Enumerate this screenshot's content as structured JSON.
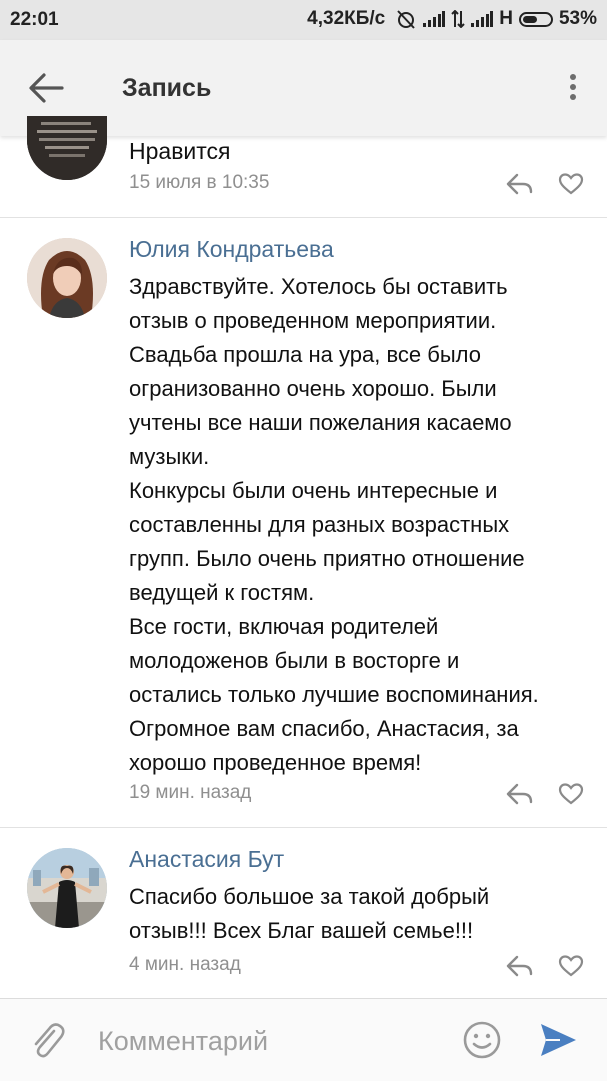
{
  "status_bar": {
    "time": "22:01",
    "speed": "4,32КБ/с",
    "network": "H",
    "battery": "53%",
    "battery_level": 0.53
  },
  "header": {
    "title": "Запись",
    "back_icon": "arrow-left-icon",
    "more_icon": "more-vertical-icon"
  },
  "comments": [
    {
      "text": "Нравится",
      "time": "15 июля в 10:35"
    },
    {
      "author": "Юлия Кондратьева",
      "text": "Здравствуйте. Хотелось бы оставить\nотзыв о проведенном мероприятии.\nСвадьба прошла на ура, все было\nогранизованно очень хорошо. Были\nучтены все наши пожелания касаемо\nмузыки.\nКонкурсы были очень интересные и\nсоставленны для разных возрастных\nгрупп. Было очень приятно отношение\nведущей к гостям.\nВсе гости, включая родителей\nмолодоженов были в восторге и\nостались только лучшие воспоминания.\nОгромное вам спасибо, Анастасия, за\nхорошо проведенное время!",
      "time": "19 мин. назад"
    },
    {
      "author": "Анастасия Бут",
      "text": "Спасибо большое за такой добрый\nотзыв!!! Всех Благ вашей семье!!!",
      "time": "4 мин. назад"
    }
  ],
  "input": {
    "placeholder": "Комментарий"
  },
  "colors": {
    "author": "#4a6f93",
    "send": "#4a7fc1",
    "timestamp": "#8f8f8f"
  }
}
